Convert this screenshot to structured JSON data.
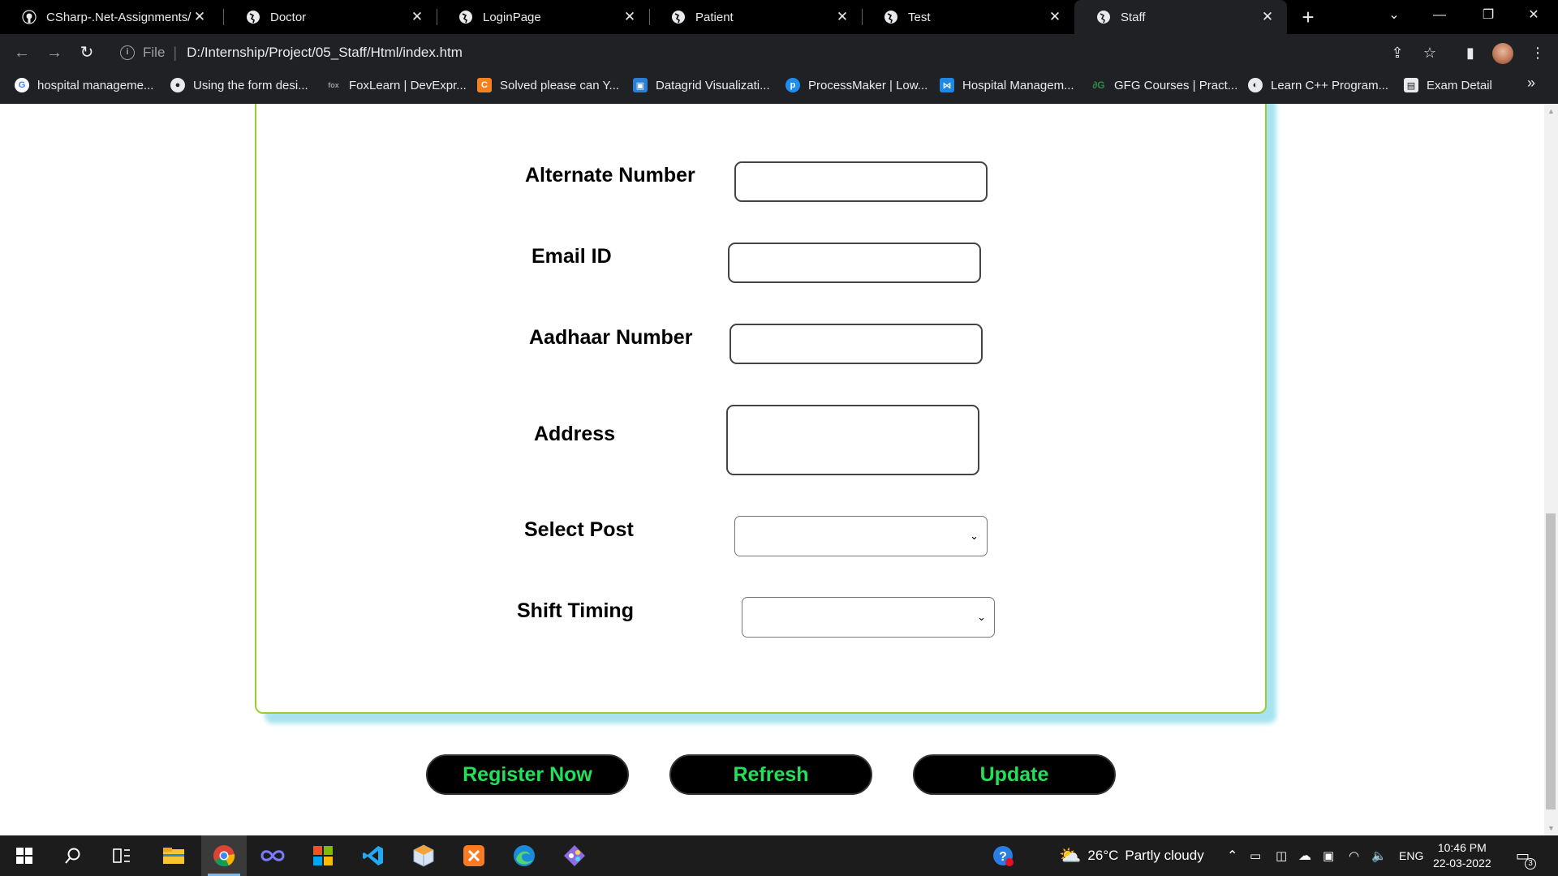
{
  "browser": {
    "tabs": [
      {
        "title": "CSharp-.Net-Assignments/",
        "icon": "github-icon"
      },
      {
        "title": "Doctor",
        "icon": "globe-icon"
      },
      {
        "title": "LoginPage",
        "icon": "globe-icon"
      },
      {
        "title": "Patient",
        "icon": "globe-icon"
      },
      {
        "title": "Test",
        "icon": "globe-icon"
      },
      {
        "title": "Staff",
        "icon": "globe-icon",
        "active": true
      }
    ],
    "address_scheme": "File",
    "address_url": "D:/Internship/Project/05_Staff/Html/index.htm",
    "bookmarks": [
      {
        "label": "hospital manageme...",
        "icon": "google-icon"
      },
      {
        "label": "Using the form desi...",
        "icon": "github-icon"
      },
      {
        "label": "FoxLearn | DevExpr...",
        "icon": "foxlearn-icon"
      },
      {
        "label": "Solved please can Y...",
        "icon": "chegg-icon"
      },
      {
        "label": "Datagrid Visualizati...",
        "icon": "datagrid-icon"
      },
      {
        "label": "ProcessMaker | Low...",
        "icon": "processmaker-icon"
      },
      {
        "label": "Hospital Managem...",
        "icon": "visual-studio-icon"
      },
      {
        "label": "GFG Courses | Pract...",
        "icon": "gfg-icon"
      },
      {
        "label": "Learn C++ Program...",
        "icon": "globe-icon"
      },
      {
        "label": "Exam Detail",
        "icon": "exam-icon"
      }
    ],
    "bookmarks_more": "»"
  },
  "form": {
    "fields": [
      {
        "label": "Alternate Number",
        "type": "input",
        "value": ""
      },
      {
        "label": "Email ID",
        "type": "input",
        "value": ""
      },
      {
        "label": "Aadhaar Number",
        "type": "input",
        "value": ""
      },
      {
        "label": "Address",
        "type": "textarea",
        "value": ""
      },
      {
        "label": "Select Post",
        "type": "select",
        "value": ""
      },
      {
        "label": "Shift Timing",
        "type": "select",
        "value": ""
      }
    ],
    "buttons": {
      "register": "Register Now",
      "refresh": "Refresh",
      "update": "Update"
    },
    "colors": {
      "card_border": "#9acd32",
      "card_shadow": "#a8e4ef",
      "button_bg": "#000000",
      "button_text": "#22e05a"
    }
  },
  "taskbar": {
    "weather_temp": "26°C",
    "weather_text": "Partly cloudy",
    "language": "ENG",
    "time": "10:46 PM",
    "date": "22-03-2022",
    "notification_count": "3"
  }
}
